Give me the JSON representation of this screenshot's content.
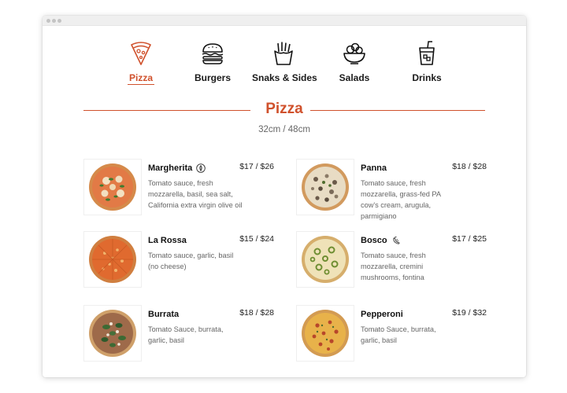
{
  "menu": {
    "tabs": [
      {
        "label": "Pizza",
        "icon": "pizza-slice-icon",
        "active": true
      },
      {
        "label": "Burgers",
        "icon": "burger-icon",
        "active": false
      },
      {
        "label": "Snaks & Sides",
        "icon": "fries-icon",
        "active": false
      },
      {
        "label": "Salads",
        "icon": "salad-bowl-icon",
        "active": false
      },
      {
        "label": "Drinks",
        "icon": "drink-cup-icon",
        "active": false
      }
    ]
  },
  "section": {
    "title": "Pizza",
    "subtitle": "32cm / 48cm"
  },
  "items": [
    {
      "name": "Margherita",
      "price": "$17 / $26",
      "description": "Tomato sauce, fresh mozzarella, basil, sea salt, California extra virgin olive oil",
      "badge": "vegetarian-leaf-icon"
    },
    {
      "name": "Panna",
      "price": "$18 / $28",
      "description": "Tomato sauce, fresh mozzarella, grass-fed PA cow's cream, arugula, parmigiano",
      "badge": ""
    },
    {
      "name": "La Rossa",
      "price": "$15 / $24",
      "description": "Tomato sauce, garlic, basil (no cheese)",
      "badge": ""
    },
    {
      "name": "Bosco",
      "price": "$17 / $25",
      "description": "Tomato sauce, fresh mozzarella, cremini mushrooms, fontina",
      "badge": "spicy-pepper-icon"
    },
    {
      "name": "Burrata",
      "price": "$18 / $28",
      "description": "Tomato Sauce, burrata, garlic, basil",
      "badge": ""
    },
    {
      "name": "Pepperoni",
      "price": "$19 / $32",
      "description": "Tomato Sauce, burrata, garlic, basil",
      "badge": ""
    }
  ],
  "colors": {
    "accent": "#d0512c",
    "text": "#1a1a1a",
    "muted": "#666666"
  }
}
